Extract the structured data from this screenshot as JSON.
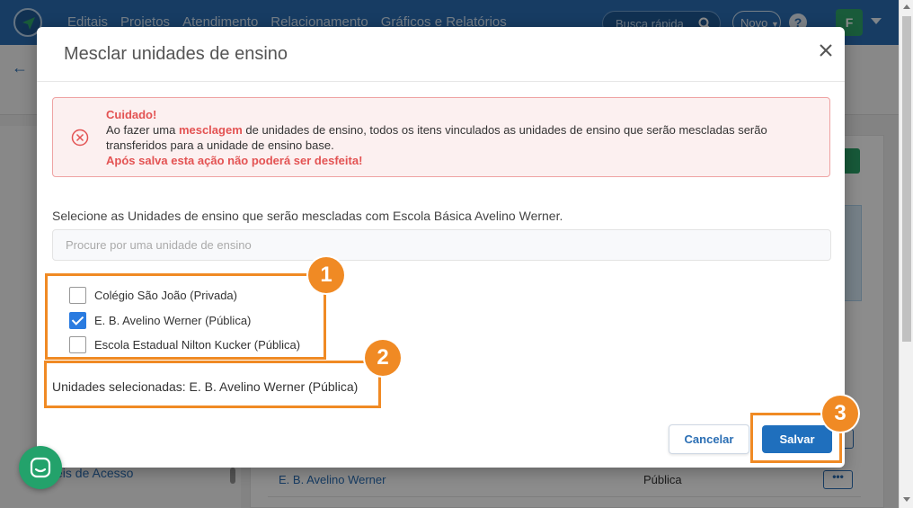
{
  "topbar": {
    "nav": [
      "Editais",
      "Projetos",
      "Atendimento",
      "Relacionamento",
      "Gráficos e Relatórios"
    ],
    "search_label": "Busca rápida",
    "new_label": "Novo",
    "help_label": "?",
    "avatar_initial": "F"
  },
  "background": {
    "sidebar_link": "eis de Acesso",
    "table_row": {
      "name": "E. B. Avelino Werner",
      "type": "Pública",
      "actions": "•••"
    }
  },
  "modal": {
    "title": "Mesclar unidades de ensino",
    "close_label": "×",
    "alert": {
      "heading": "Cuidado!",
      "text_before": "Ao fazer uma ",
      "text_emphasis": "mesclagem",
      "text_after": " de unidades de ensino, todos os itens vinculados as unidades de ensino que serão mescladas serão transferidos para a unidade de ensino base.",
      "warning": "Após salva esta ação não poderá ser desfeita!"
    },
    "select_label": "Selecione as Unidades de ensino que serão mescladas com Escola Básica Avelino Werner.",
    "search_placeholder": "Procure por uma unidade de ensino",
    "options": [
      {
        "label": "Colégio São João (Privada)",
        "checked": false
      },
      {
        "label": "E. B. Avelino Werner (Pública)",
        "checked": true
      },
      {
        "label": "Escola Estadual Nilton Kucker (Pública)",
        "checked": false
      }
    ],
    "selected_text": "Unidades selecionadas: E. B. Avelino Werner (Pública)",
    "cancel_label": "Cancelar",
    "save_label": "Salvar"
  },
  "annotations": [
    "1",
    "2",
    "3"
  ],
  "colors": {
    "brand_blue": "#2a6eb4",
    "annotation_orange": "#f08a24",
    "alert_red": "#e35353",
    "check_blue": "#2a7be0",
    "chat_green": "#23a26b"
  }
}
